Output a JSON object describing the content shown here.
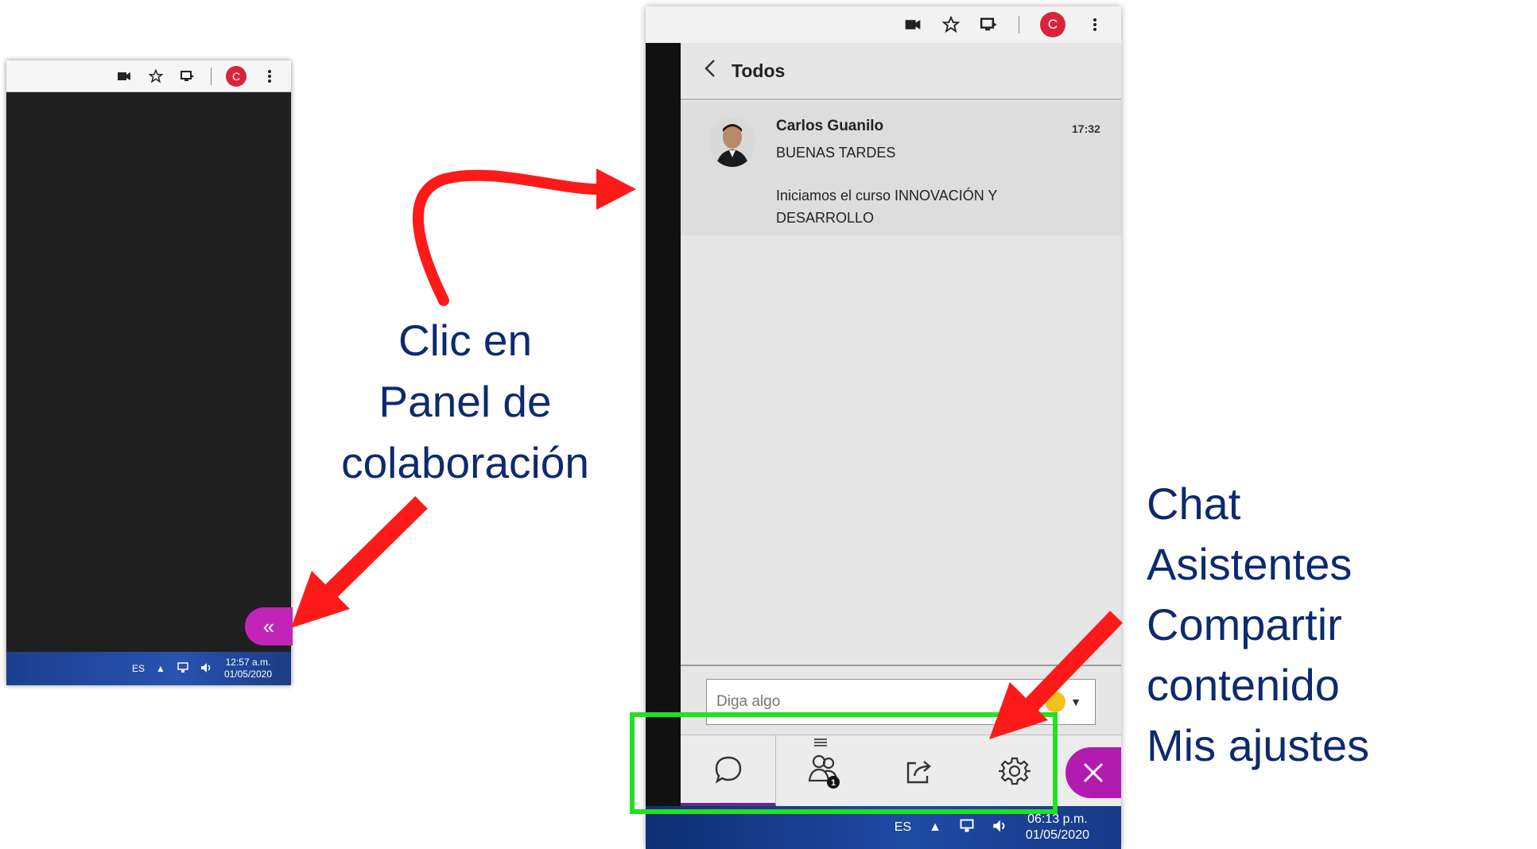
{
  "left_window": {
    "taskbar": {
      "lang": "ES",
      "time": "12:57 a.m.",
      "date": "01/05/2020"
    },
    "profile_letter": "C",
    "panel_button_glyph": "«"
  },
  "right_window": {
    "profile_letter": "C",
    "header": {
      "title": "Todos"
    },
    "message": {
      "author": "Carlos Guanilo",
      "time": "17:32",
      "line1": "BUENAS TARDES",
      "line2": "Iniciamos el curso INNOVACIÓN Y DESARROLLO"
    },
    "compose": {
      "placeholder": "Diga algo"
    },
    "tabs": [
      {
        "name": "chat",
        "icon": "chat-bubble-icon"
      },
      {
        "name": "attendees",
        "icon": "attendees-icon",
        "badge": "1"
      },
      {
        "name": "share",
        "icon": "share-content-icon"
      },
      {
        "name": "settings",
        "icon": "gear-icon"
      }
    ],
    "taskbar": {
      "lang": "ES",
      "time": "06:13 p.m.",
      "date": "01/05/2020"
    }
  },
  "annotations": {
    "left": {
      "line1": "Clic en",
      "line2": "Panel de",
      "line3": "colaboración"
    },
    "right": {
      "line1": "Chat",
      "line2": "Asistentes",
      "line3": "Compartir contenido",
      "line4": "Mis ajustes"
    }
  },
  "colors": {
    "arrow": "#ff1a1a",
    "highlight": "#22e022",
    "annotation_text": "#0d2a6f",
    "panel_button": "#c025b8"
  }
}
